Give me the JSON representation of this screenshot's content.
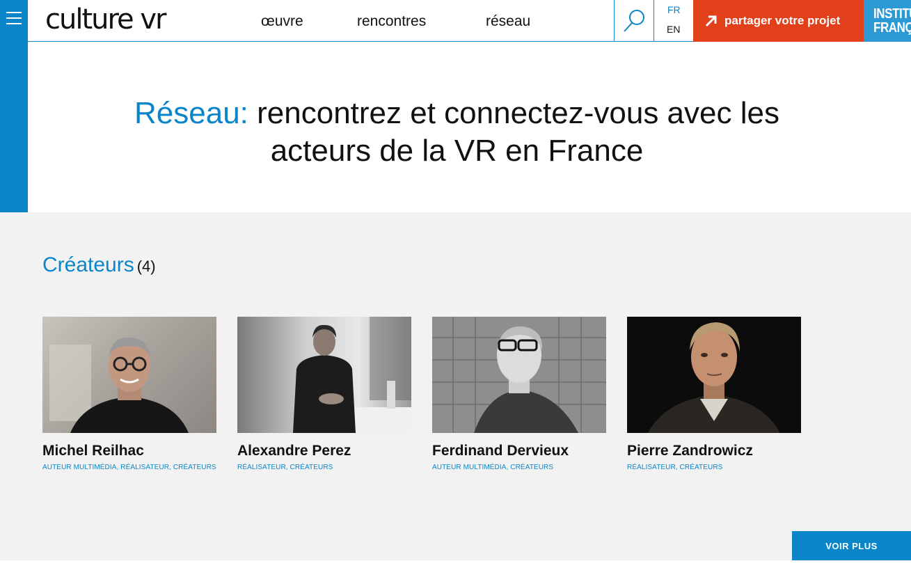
{
  "header": {
    "logo": "culture vr",
    "nav": [
      "œuvre",
      "rencontres",
      "réseau"
    ],
    "lang_fr": "FR",
    "lang_en": "EN",
    "share_label": "partager votre projet",
    "partner_line1": "INSTITUT",
    "partner_line2": "FRANÇAIS"
  },
  "hero": {
    "title_accent": "Réseau:",
    "title_rest_line1": " rencontrez et connectez-vous avec les",
    "title_line2": "acteurs de la VR en France"
  },
  "creators": {
    "title": "Créateurs",
    "count": "(4)",
    "people": [
      {
        "name": "Michel Reilhac",
        "tags": "AUTEUR MULTIMÉDIA, RÉALISATEUR, CRÉATEURS"
      },
      {
        "name": "Alexandre Perez",
        "tags": "RÉALISATEUR, CRÉATEURS"
      },
      {
        "name": "Ferdinand Dervieux",
        "tags": "AUTEUR MULTIMÉDIA, CRÉATEURS"
      },
      {
        "name": "Pierre Zandrowicz",
        "tags": "RÉALISATEUR, CRÉATEURS"
      }
    ],
    "more_label": "VOIR PLUS"
  },
  "colors": {
    "accent": "#0a86c8",
    "share": "#e2401a",
    "partner": "#2b9ad4",
    "section_bg": "#f2f2f2"
  }
}
